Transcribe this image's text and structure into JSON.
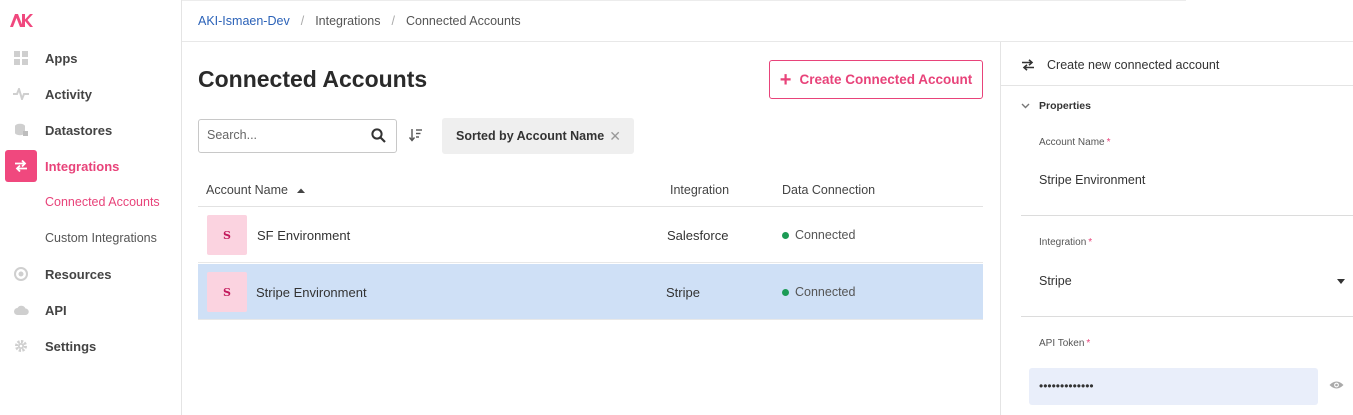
{
  "brand": {
    "logo_text": "AK",
    "accent_color": "#e8437a"
  },
  "sidebar": {
    "items": [
      {
        "label": "Apps",
        "icon": "apps-grid-icon"
      },
      {
        "label": "Activity",
        "icon": "activity-pulse-icon"
      },
      {
        "label": "Datastores",
        "icon": "datastores-icon"
      },
      {
        "label": "Integrations",
        "icon": "integrations-swap-icon",
        "active": true
      },
      {
        "label": "Resources",
        "icon": "resources-icon"
      },
      {
        "label": "API",
        "icon": "cloud-icon"
      },
      {
        "label": "Settings",
        "icon": "gear-icon"
      }
    ],
    "sub_items": [
      {
        "label": "Connected Accounts",
        "active": true
      },
      {
        "label": "Custom Integrations"
      }
    ]
  },
  "breadcrumb": {
    "items": [
      "AKI-Ismaen-Dev",
      "Integrations",
      "Connected Accounts"
    ],
    "separator": "/"
  },
  "main": {
    "title": "Connected Accounts",
    "create_button": "Create Connected Account",
    "search": {
      "placeholder": "Search...",
      "value": ""
    },
    "sort_chip": "Sorted by Account Name",
    "table": {
      "columns": [
        "Account Name",
        "Integration",
        "Data Connection"
      ],
      "rows": [
        {
          "avatar": "S",
          "name": "SF Environment",
          "integration": "Salesforce",
          "status": "Connected",
          "selected": false
        },
        {
          "avatar": "S",
          "name": "Stripe Environment",
          "integration": "Stripe",
          "status": "Connected",
          "selected": true
        }
      ],
      "status_color": "#1c9b55",
      "selected_row_color": "#cfe0f6"
    }
  },
  "panel": {
    "header": "Create new connected account",
    "section": "Properties",
    "fields": {
      "account_name": {
        "label": "Account Name",
        "required_mark": "*",
        "value": "Stripe Environment"
      },
      "integration": {
        "label": "Integration",
        "required_mark": "*",
        "value": "Stripe"
      },
      "api_token": {
        "label": "API Token",
        "required_mark": "*",
        "value": "•••••••••••••"
      }
    }
  }
}
